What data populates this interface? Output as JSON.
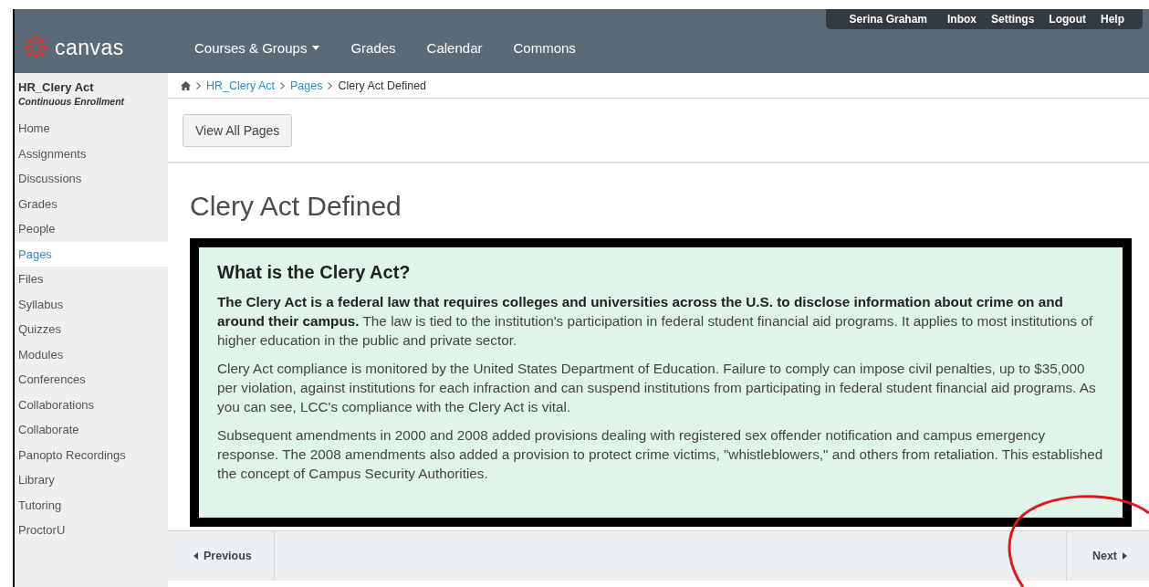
{
  "header": {
    "logo": "canvas",
    "nav": [
      {
        "label": "Courses & Groups",
        "kind": "dropdown"
      },
      {
        "label": "Grades",
        "kind": "link"
      },
      {
        "label": "Calendar",
        "kind": "link"
      },
      {
        "label": "Commons",
        "kind": "link"
      }
    ],
    "user_menu": [
      "Serina Graham",
      "Inbox",
      "Settings",
      "Logout",
      "Help"
    ]
  },
  "sidebar": {
    "course": "HR_Clery Act",
    "term": "Continuous Enrollment",
    "items": [
      {
        "label": "Home",
        "selected": false
      },
      {
        "label": "Assignments",
        "selected": false
      },
      {
        "label": "Discussions",
        "selected": false
      },
      {
        "label": "Grades",
        "selected": false
      },
      {
        "label": "People",
        "selected": false
      },
      {
        "label": "Pages",
        "selected": true
      },
      {
        "label": "Files",
        "selected": false
      },
      {
        "label": "Syllabus",
        "selected": false
      },
      {
        "label": "Quizzes",
        "selected": false
      },
      {
        "label": "Modules",
        "selected": false
      },
      {
        "label": "Conferences",
        "selected": false
      },
      {
        "label": "Collaborations",
        "selected": false
      },
      {
        "label": "Collaborate",
        "selected": false
      },
      {
        "label": "Panopto Recordings",
        "selected": false
      },
      {
        "label": "Library",
        "selected": false
      },
      {
        "label": "Tutoring",
        "selected": false
      },
      {
        "label": "ProctorU",
        "selected": false
      }
    ]
  },
  "breadcrumb": [
    "HR_Clery Act",
    "Pages",
    "Clery Act Defined"
  ],
  "view_all_button": "View All Pages",
  "page": {
    "title": "Clery Act Defined",
    "box_heading": "What is the Clery Act?",
    "paragraphs": [
      "**The Clery Act is a federal law that requires colleges and universities across the U.S. to disclose information about crime on and around their campus.** The law is tied to the institution's participation in federal student financial aid programs. It applies to most institutions of higher education in the public and private sector.",
      "Clery Act compliance is monitored by the United States Department of Education. Failure to comply can impose civil penalties, up to $35,000 per violation, against institutions for each infraction and can suspend institutions from participating in federal student financial aid programs. As you can see, LCC's compliance with the Clery Act is vital.",
      "Subsequent amendments in 2000 and 2008 added provisions dealing with registered sex offender notification and campus emergency response. The 2008 amendments also added a provision to protect crime victims, \"whistleblowers,\" and others from retaliation. This established the concept of Campus Security Authorities."
    ]
  },
  "footer": {
    "previous": "Previous",
    "next": "Next"
  }
}
